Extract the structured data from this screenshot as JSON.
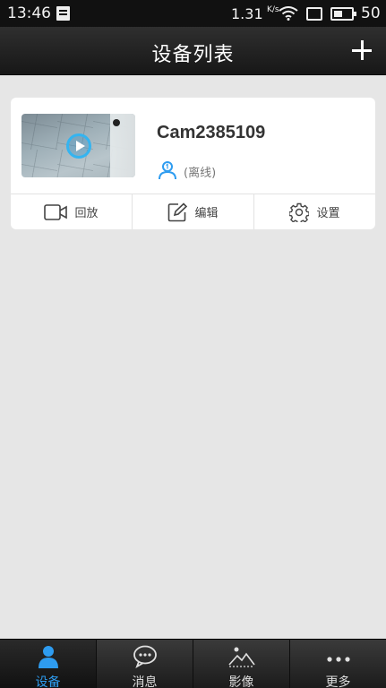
{
  "status_bar": {
    "time": "13:46",
    "speed": "1.31",
    "speed_unit": "K/s",
    "battery_level": "50"
  },
  "header": {
    "title": "设备列表",
    "add_icon": "plus-icon"
  },
  "device": {
    "name": "Cam2385109",
    "status": "(离线)",
    "actions": [
      {
        "label": "回放",
        "icon": "video-camera-icon"
      },
      {
        "label": "编辑",
        "icon": "edit-icon"
      },
      {
        "label": "设置",
        "icon": "gear-icon"
      }
    ]
  },
  "bottom_nav": {
    "items": [
      {
        "label": "设备",
        "icon": "person-icon",
        "active": true
      },
      {
        "label": "消息",
        "icon": "chat-bubble-icon",
        "active": false
      },
      {
        "label": "影像",
        "icon": "mountain-image-icon",
        "active": false
      },
      {
        "label": "更多",
        "icon": "more-dots-icon",
        "active": false
      }
    ]
  },
  "colors": {
    "accent": "#2e9cf0",
    "play_ring": "#34b4f0",
    "background": "#e6e6e6"
  }
}
